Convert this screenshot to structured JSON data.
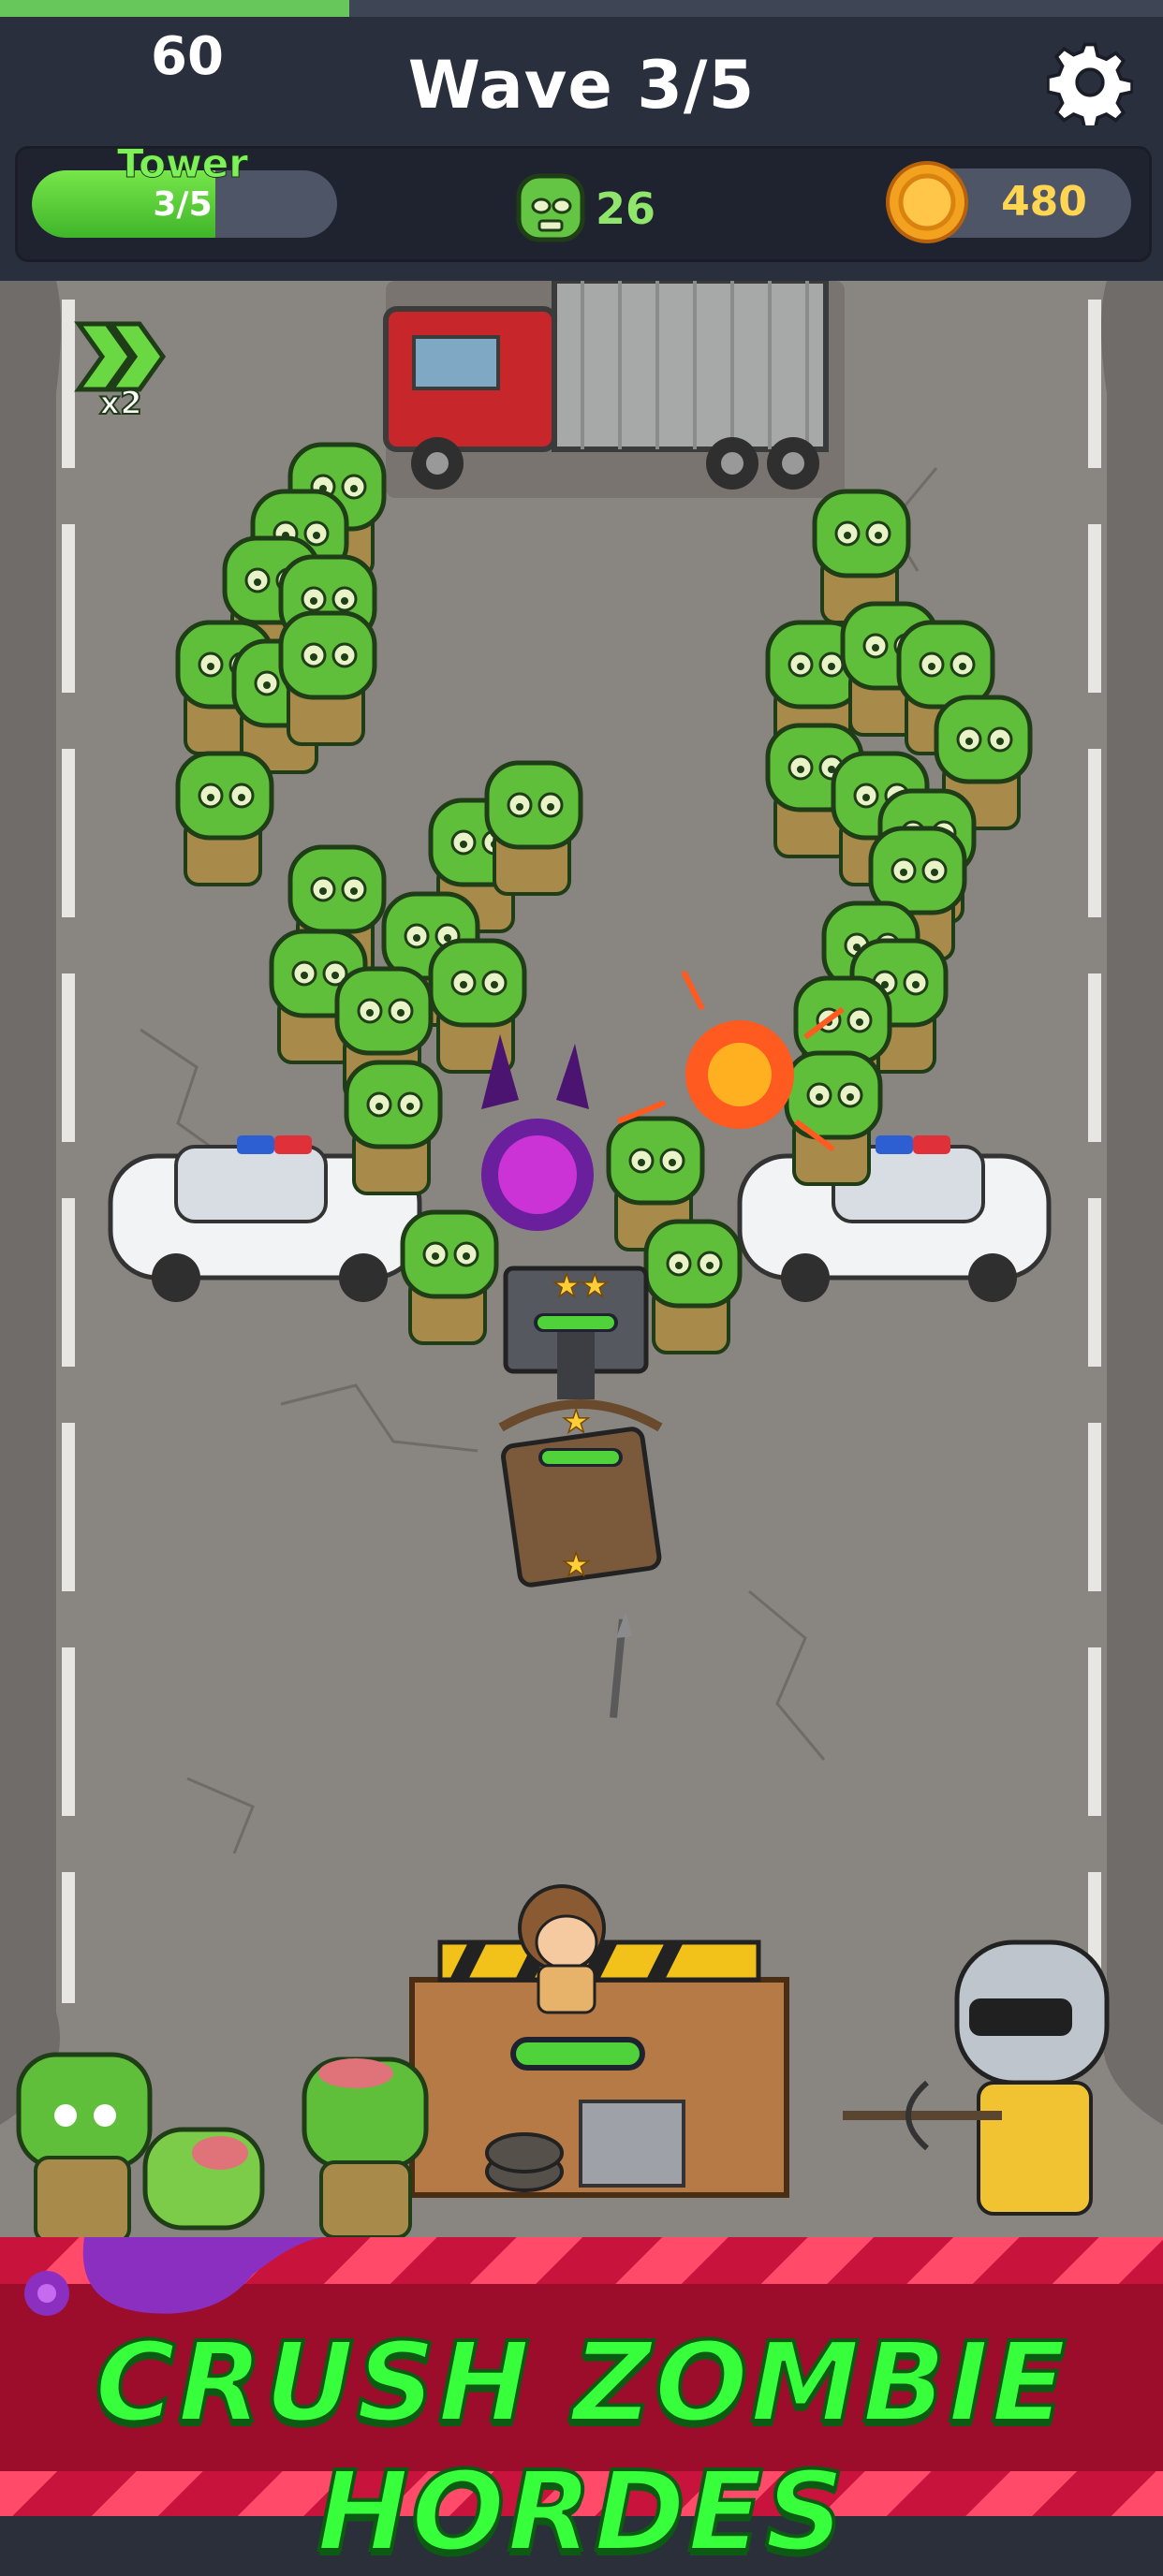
{
  "hud": {
    "timer": "60",
    "wave_title": "Wave 3/5",
    "wave_progress": 0.3,
    "tower": {
      "label": "Tower",
      "count": "3/5",
      "progress": 0.6
    },
    "zombie_count": "26",
    "coins": "480",
    "icons": {
      "settings": "gear-icon",
      "zombies": "zombie-head-icon",
      "coins": "coin-icon"
    }
  },
  "field": {
    "speed_label": "x2",
    "turrets": [
      {
        "name": "crossbow-turret",
        "stars": 2,
        "health": 1.0
      },
      {
        "name": "ballista-turret",
        "stars": 2,
        "health": 1.0
      }
    ],
    "base_health": 1.0
  },
  "banner": {
    "text": "CRUSH ZOMBIE HORDES"
  },
  "colors": {
    "hud_bg": "#2a2f3d",
    "road": "#898580",
    "zombie_green": "#5fbf3a",
    "health_green": "#4fd23a",
    "coin_gold": "#f3a21f",
    "banner_red": "#c8143c",
    "banner_text": "#38ff3c"
  }
}
